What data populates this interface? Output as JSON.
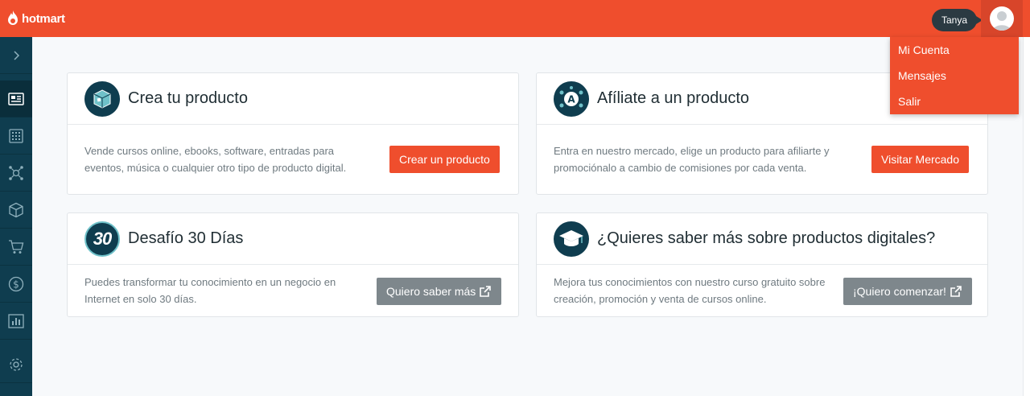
{
  "brand": {
    "name": "hotmart"
  },
  "header": {
    "user_name": "Tanya"
  },
  "user_menu": {
    "items": [
      {
        "label": "Mi Cuenta"
      },
      {
        "label": "Mensajes"
      },
      {
        "label": "Salir"
      }
    ]
  },
  "sidebar": {
    "items": [
      {
        "icon": "chevron-right-icon"
      },
      {
        "icon": "dashboard-icon"
      },
      {
        "icon": "apps-grid-icon"
      },
      {
        "icon": "affiliate-network-icon"
      },
      {
        "icon": "product-box-icon"
      },
      {
        "icon": "cart-icon"
      },
      {
        "icon": "dollar-icon"
      },
      {
        "icon": "bar-chart-icon"
      },
      {
        "icon": "settings-gear-icon"
      }
    ]
  },
  "cards": {
    "create": {
      "title": "Crea tu producto",
      "text": "Vende cursos online, ebooks, software, entradas para eventos, música o cualquier otro tipo de producto digital.",
      "button": "Crear un producto"
    },
    "affiliate": {
      "title": "Afíliate a un producto",
      "text": "Entra en nuestro mercado, elige un producto para afiliarte y promociónalo a cambio de comisiones por cada venta.",
      "button": "Visitar Mercado"
    },
    "challenge": {
      "title": "Desafío 30 Días",
      "badge": "30",
      "text": "Puedes transformar tu conocimiento en un negocio en Internet en solo 30 días.",
      "button": "Quiero saber más"
    },
    "learn": {
      "title": "¿Quieres saber más sobre productos digitales?",
      "text": "Mejora tus conocimientos con nuestro curso gratuito sobre creación, promoción y venta de cursos online.",
      "button": "¡Quiero comenzar!"
    }
  },
  "colors": {
    "brand": "#ef4e2d",
    "sidebar": "#0f3d4f",
    "grey_button": "#7e878c"
  }
}
